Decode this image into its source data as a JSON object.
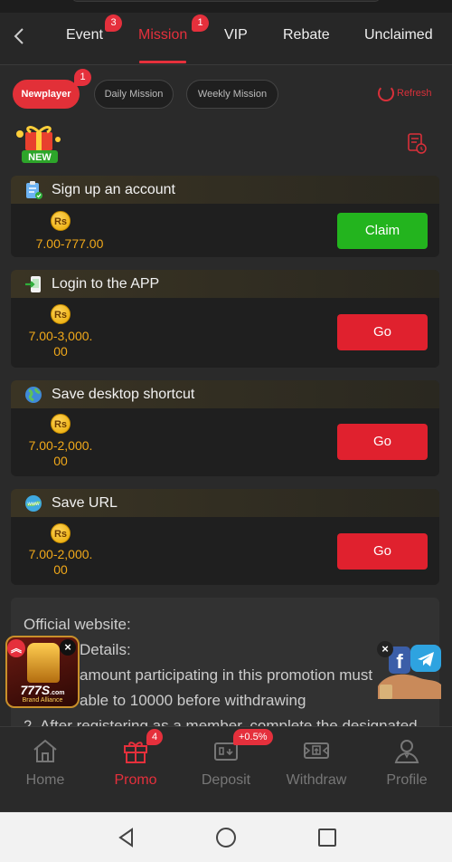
{
  "header": {
    "tabs": [
      {
        "label": "Event",
        "badge": "3"
      },
      {
        "label": "Mission",
        "badge": "1",
        "active": true
      },
      {
        "label": "VIP"
      },
      {
        "label": "Rebate"
      },
      {
        "label": "Unclaimed"
      }
    ]
  },
  "filters": {
    "chips": [
      {
        "label": "Newplayer",
        "badge": "1",
        "active": true
      },
      {
        "label": "Daily Mission"
      },
      {
        "label": "Weekly Mission"
      }
    ],
    "refresh_label": "Refresh"
  },
  "new_badge": "NEW",
  "coin_symbol": "Rs",
  "tasks": [
    {
      "title": "Sign up an account",
      "icon": "clipboard-icon",
      "reward": "7.00-777.00",
      "button": "Claim",
      "button_color": "#23b41e"
    },
    {
      "title": "Login to the APP",
      "icon": "login-icon",
      "reward_line1": "7.00-3,000.",
      "reward_line2": "00",
      "button": "Go",
      "button_color": "#e0212e"
    },
    {
      "title": "Save desktop shortcut",
      "icon": "globe-icon",
      "reward_line1": "7.00-2,000.",
      "reward_line2": "00",
      "button": "Go",
      "button_color": "#e0212e"
    },
    {
      "title": "Save URL",
      "icon": "www-icon",
      "reward_line1": "7.00-2,000.",
      "reward_line2": "00",
      "button": "Go",
      "button_color": "#e0212e"
    }
  ],
  "rules": {
    "lines": [
      "Official website:",
      "Details:",
      "amount participating in this promotion must",
      "able to 10000 before withdrawing",
      "2. After registering as a member, complete the designated"
    ]
  },
  "floating_promo": {
    "brand": "777S",
    "brand_suffix": ".com",
    "sub": "Brand Alliance"
  },
  "bottom_nav": [
    {
      "label": "Home",
      "icon": "home-icon"
    },
    {
      "label": "Promo",
      "icon": "gift-icon",
      "badge": "4",
      "active": true
    },
    {
      "label": "Deposit",
      "icon": "wallet-icon",
      "badge": "+0.5%"
    },
    {
      "label": "Withdraw",
      "icon": "withdraw-icon"
    },
    {
      "label": "Profile",
      "icon": "profile-icon"
    }
  ],
  "colors": {
    "accent": "#e5303c",
    "reward": "#f0a81a",
    "claim": "#23b41e"
  }
}
